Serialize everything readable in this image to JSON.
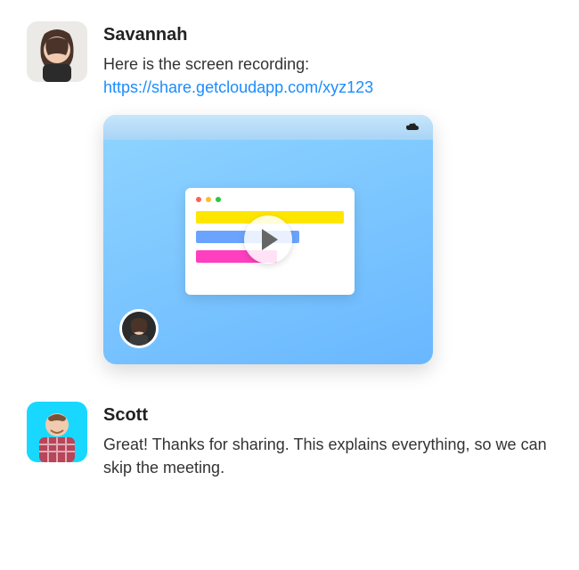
{
  "messages": [
    {
      "sender": "Savannah",
      "text_before_link": "Here is the screen recording:",
      "link": "https://share.getcloudapp.com/xyz123"
    },
    {
      "sender": "Scott",
      "text": "Great! Thanks for sharing. This explains everything, so we can skip the meeting."
    }
  ],
  "link_color": "#1a8cff"
}
